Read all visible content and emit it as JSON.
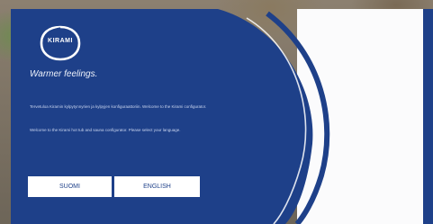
{
  "brand": {
    "logo_text": "KIRAMI",
    "tagline": "Warmer feelings."
  },
  "intro": {
    "paragraph_1": "Tervetuloa Kiramin kylpytynnyrien ja kylpyjen konfiguraattoriin. Welcome to the Kirami configurator.",
    "paragraph_2": "Welcome to the Kirami hot tub and sauna configurator. Please select your language."
  },
  "language_buttons": {
    "finnish": "SUOMI",
    "english": "ENGLISH"
  },
  "colors": {
    "panel_blue": "#1e4089",
    "button_bg": "#ffffff",
    "button_text": "#1e4089"
  }
}
